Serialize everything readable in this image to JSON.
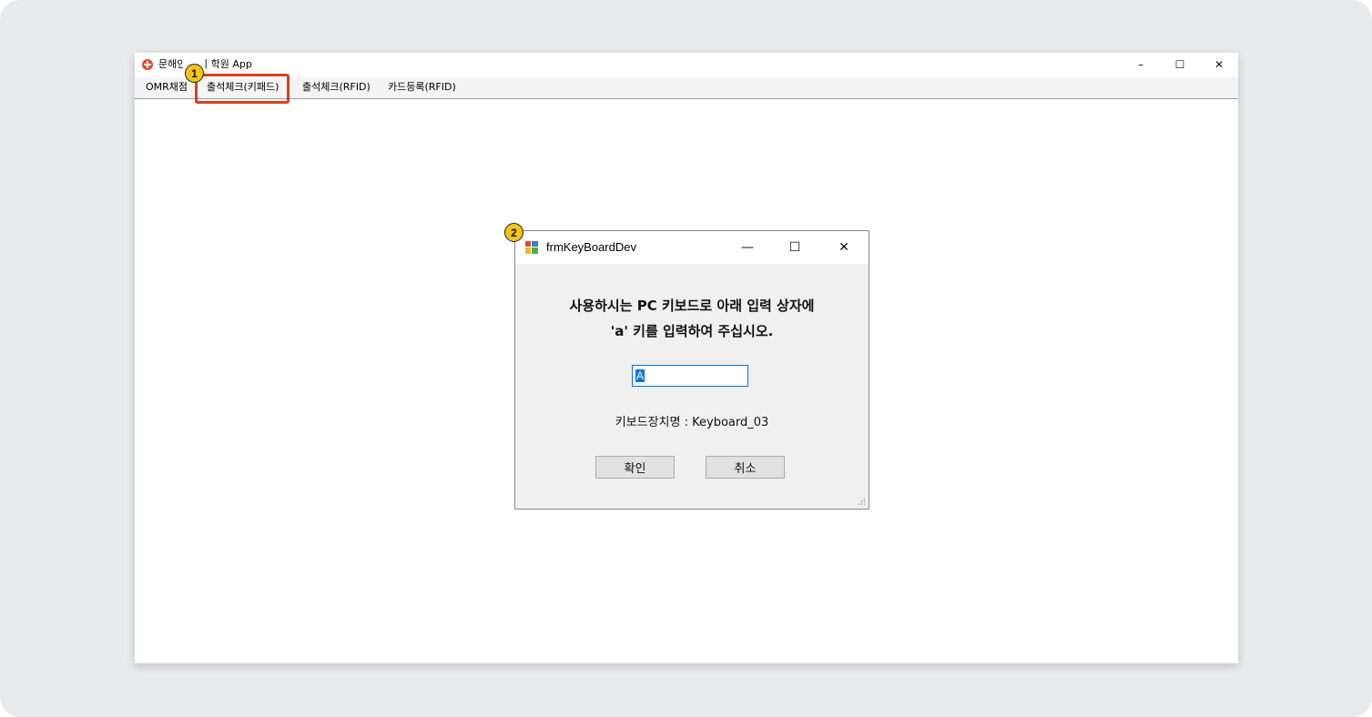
{
  "app": {
    "title": "문해인 달리 학원 App",
    "window_controls": {
      "minimize": "–",
      "maximize": "☐",
      "close": "✕"
    }
  },
  "menu": {
    "items": [
      {
        "label": "OMR채점"
      },
      {
        "label": "출석체크(키패드)"
      },
      {
        "label": "출석체크(RFID)"
      },
      {
        "label": "카드등록(RFID)"
      }
    ]
  },
  "badges": {
    "first": "1",
    "second": "2"
  },
  "dialog": {
    "title": "frmKeyBoardDev",
    "controls": {
      "minimize": "—",
      "maximize": "☐",
      "close": "✕"
    },
    "message_line1": "사용하시는 PC 키보드로 아래 입력 상자에",
    "message_line2": "'a' 키를 입력하여 주십시오.",
    "input_value": "A",
    "device_label": "키보드장치명 :",
    "device_name": "Keyboard_03",
    "ok_label": "확인",
    "cancel_label": "취소"
  },
  "colors": {
    "highlight": "#d9401b",
    "badge": "#f2c418",
    "input_border": "#0078d7"
  }
}
